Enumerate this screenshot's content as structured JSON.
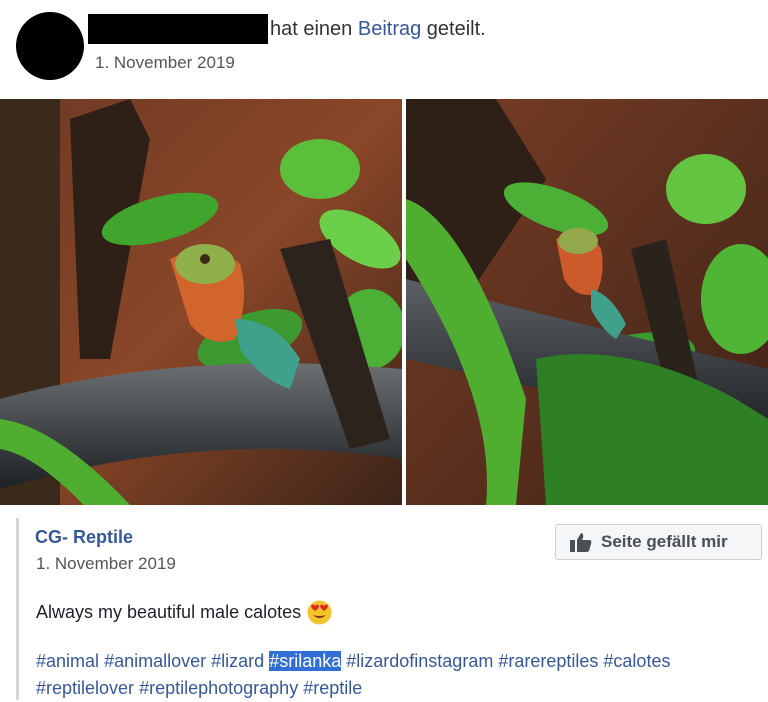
{
  "header": {
    "action_text": "hat einen",
    "link_text": "Beitrag",
    "action_suffix": "geteilt.",
    "date": "1. November 2019"
  },
  "shared_post": {
    "page_name": "CG- Reptile",
    "date": "1. November 2019",
    "like_button_label": "Seite gefällt mir",
    "like_icon": "thumbs-up-icon",
    "caption": "Always my beautiful male calotes",
    "caption_emoji": "heart-eyes-emoji",
    "hashtags": [
      "#animal",
      "#animallover",
      "#lizard",
      "#srilanka",
      "#lizardofinstagram",
      "#rarereptiles",
      "#calotes",
      "#reptilelover",
      "#reptilephotography",
      "#reptile"
    ],
    "highlighted_hashtag": "#srilanka"
  },
  "colors": {
    "link": "#365899",
    "highlight": "#2f6fd6",
    "text": "#1d2129"
  }
}
